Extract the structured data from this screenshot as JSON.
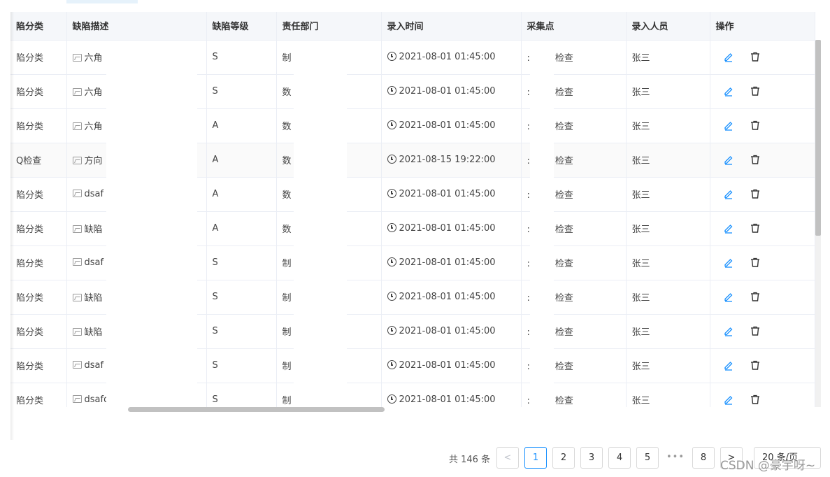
{
  "table": {
    "headers": [
      "陷分类",
      "缺陷描述",
      "缺陷等级",
      "责任部门",
      "录入时间",
      "采集点",
      "录入人员",
      "操作"
    ],
    "rows": [
      {
        "category": "陷分类",
        "desc": "六角",
        "level": "S",
        "dept": "制",
        "time": "2021-08-01 01:45:00",
        "point_prefix": ":",
        "point": "检查",
        "user": "张三"
      },
      {
        "category": "陷分类",
        "desc": "六角",
        "level": "S",
        "dept": "数",
        "time": "2021-08-01 01:45:00",
        "point_prefix": ":",
        "point": "检查",
        "user": "张三"
      },
      {
        "category": "陷分类",
        "desc": "六角",
        "level": "A",
        "dept": "数",
        "time": "2021-08-01 01:45:00",
        "point_prefix": ":",
        "point": "检查",
        "user": "张三"
      },
      {
        "category": "Q检查",
        "desc": "方向",
        "level": "A",
        "dept": "数",
        "time": "2021-08-15 19:22:00",
        "point_prefix": ":",
        "point": "检查",
        "user": "张三"
      },
      {
        "category": "陷分类",
        "desc": "dsaf",
        "level": "A",
        "dept": "数",
        "time": "2021-08-01 01:45:00",
        "point_prefix": ":",
        "point": "检查",
        "user": "张三"
      },
      {
        "category": "陷分类",
        "desc": "缺陷",
        "level": "A",
        "dept": "数",
        "time": "2021-08-01 01:45:00",
        "point_prefix": ":",
        "point": "检查",
        "user": "张三"
      },
      {
        "category": "陷分类",
        "desc": "dsaf",
        "level": "S",
        "dept": "制",
        "time": "2021-08-01 01:45:00",
        "point_prefix": ":",
        "point": "检查",
        "user": "张三"
      },
      {
        "category": "陷分类",
        "desc": "缺陷",
        "level": "S",
        "dept": "制",
        "time": "2021-08-01 01:45:00",
        "point_prefix": ":",
        "point": "检查",
        "user": "张三"
      },
      {
        "category": "陷分类",
        "desc": "缺陷",
        "level": "S",
        "dept": "制",
        "time": "2021-08-01 01:45:00",
        "point_prefix": ":",
        "point": "检查",
        "user": "张三"
      },
      {
        "category": "陷分类",
        "desc": "dsaf",
        "level": "S",
        "dept": "制",
        "time": "2021-08-01 01:45:00",
        "point_prefix": ":",
        "point": "检查",
        "user": "张三"
      },
      {
        "category": "陷分类",
        "desc": "dsafds",
        "level": "S",
        "dept": "制",
        "time": "2021-08-01 01:45:00",
        "point_prefix": ":",
        "point": "检查",
        "user": "张三"
      }
    ]
  },
  "pagination": {
    "total": "共 146 条",
    "prev": "<",
    "pages": [
      "1",
      "2",
      "3",
      "4",
      "5"
    ],
    "active_page": "1",
    "ellipsis": "•••",
    "last_page": "8",
    "next": ">",
    "page_size": "20 条/页"
  },
  "watermark": "CSDN @豪宇呀~",
  "colors": {
    "accent": "#1890ff",
    "header_bg": "#f5f7fa",
    "border": "#ebeef5"
  },
  "icons": {
    "edit": "edit-icon",
    "delete": "trash-icon",
    "image": "image-icon",
    "time": "clock-icon"
  }
}
